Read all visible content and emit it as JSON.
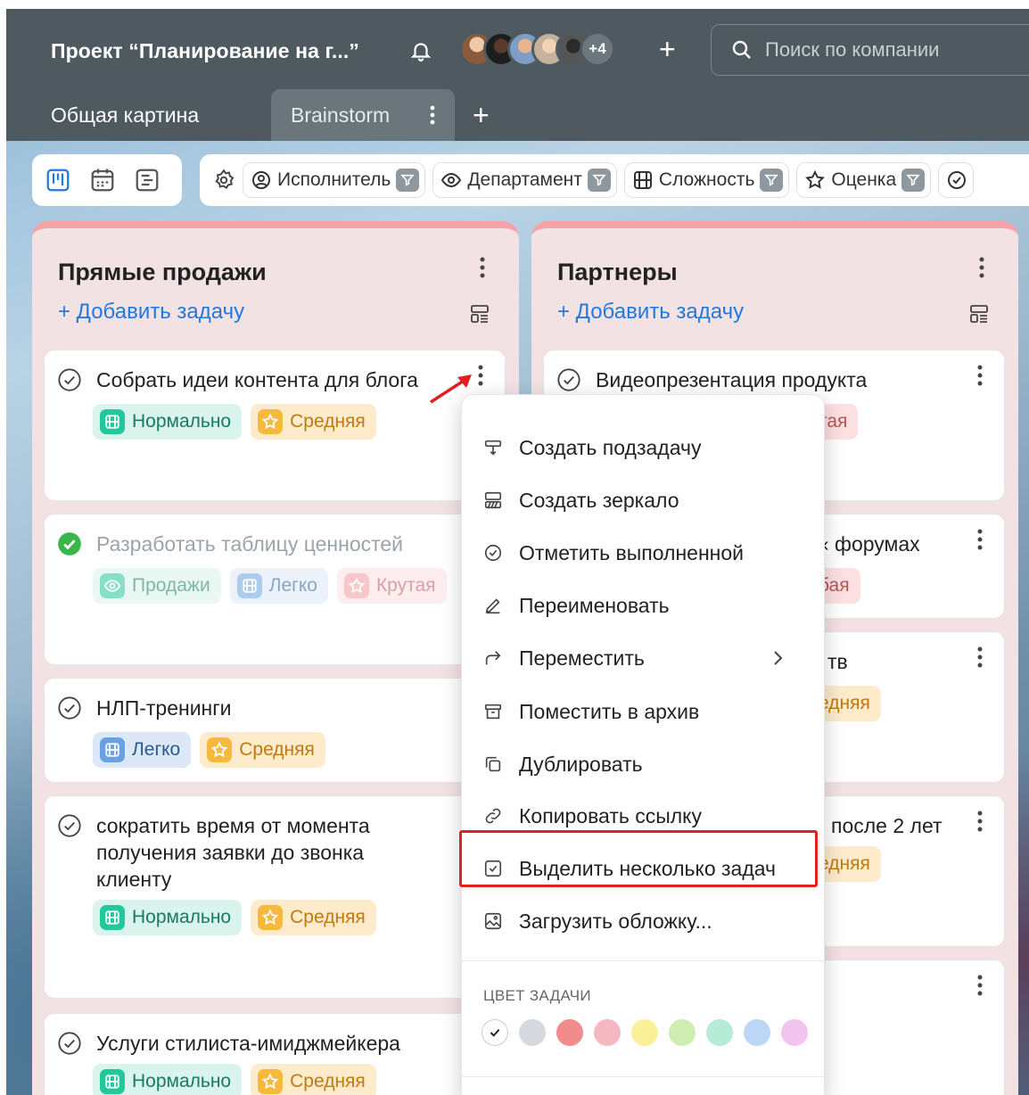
{
  "header": {
    "project_title": "Проект “Планирование на г...”",
    "avatars_more": "+4",
    "search_placeholder": "Поиск по компании"
  },
  "tabs": [
    {
      "label": "Общая картина"
    },
    {
      "label": "Brainstorm"
    }
  ],
  "filters": [
    {
      "label": "Исполнитель",
      "icon": "user-circle-icon"
    },
    {
      "label": "Департамент",
      "icon": "eye-icon"
    },
    {
      "label": "Сложность",
      "icon": "film-icon"
    },
    {
      "label": "Оценка",
      "icon": "star-icon"
    }
  ],
  "columns": [
    {
      "title": "Прямые продажи",
      "add_task": "+ Добавить задачу",
      "cards": [
        {
          "title": "Собрать идеи контента для блога",
          "tags": [
            "Нормально",
            "Средняя"
          ]
        },
        {
          "title": "Разработать таблицу ценностей",
          "tags": [
            "Продажи",
            "Легко",
            "Крутая"
          ],
          "done": true
        },
        {
          "title": "НЛП-тренинги",
          "tags": [
            "Легко",
            "Средняя"
          ]
        },
        {
          "title_lines": [
            "сократить время от момента",
            "получения заявки до звонка",
            "клиенту"
          ],
          "tags": [
            "Нормально",
            "Средняя"
          ]
        },
        {
          "title": "Услуги стилиста-имиджмейкера",
          "tags": [
            "Нормально",
            "Средняя"
          ]
        }
      ]
    },
    {
      "title": "Партнеры",
      "add_task": "+ Добавить задачу",
      "cards": [
        {
          "title": "Видеопрезентация продукта",
          "partial_tag": "тая"
        },
        {
          "partial_title": "‹ форумах",
          "partial_tag": "бая"
        },
        {
          "partial_title": "тв",
          "partial_tag": "едняя"
        },
        {
          "partial_title": "после 2 лет",
          "partial_tag": "едняя"
        }
      ]
    }
  ],
  "context_menu": {
    "items": [
      {
        "label": "Создать подзадачу",
        "icon": "subtask-icon"
      },
      {
        "label": "Создать зеркало",
        "icon": "mirror-icon"
      },
      {
        "label": "Отметить выполненной",
        "icon": "check-circle-icon"
      },
      {
        "label": "Переименовать",
        "icon": "pencil-icon"
      },
      {
        "label": "Переместить",
        "icon": "move-arrow-icon"
      },
      {
        "label": "Поместить в архив",
        "icon": "archive-icon"
      },
      {
        "label": "Дублировать",
        "icon": "duplicate-icon"
      },
      {
        "label": "Копировать ссылку",
        "icon": "link-icon"
      },
      {
        "label": "Выделить несколько задач",
        "icon": "checkbox-icon"
      },
      {
        "label": "Загрузить обложку...",
        "icon": "image-icon"
      }
    ],
    "color_label": "ЦВЕТ ЗАДАЧИ",
    "colors": [
      "#ffffff",
      "#d6d9dd",
      "#f28b8b",
      "#f6b8c0",
      "#fbf09a",
      "#cdeeb0",
      "#b4ecd8",
      "#bcd6f6",
      "#f2c4f0"
    ]
  },
  "colors": {
    "accent": "#1f7ae0",
    "highlight": "#e32020",
    "column_top": "#f4a3a6"
  }
}
